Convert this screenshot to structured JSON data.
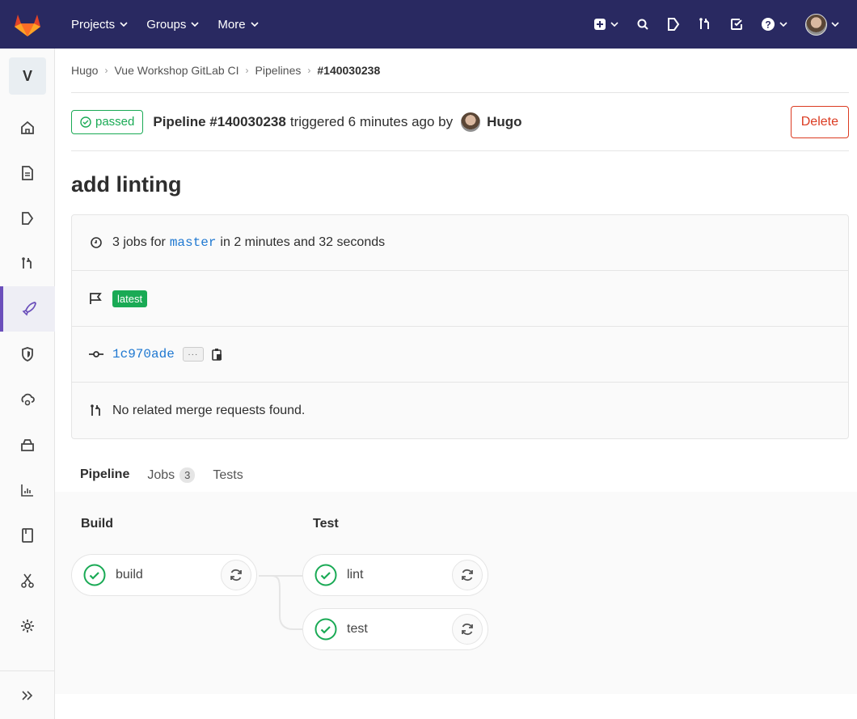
{
  "topbar": {
    "logo": "gitlab-tanuki-logo",
    "nav": [
      {
        "label": "Projects"
      },
      {
        "label": "Groups"
      },
      {
        "label": "More"
      }
    ],
    "icons": [
      "plus-square-icon",
      "search-icon",
      "issues-icon",
      "merge-request-icon",
      "todo-icon",
      "help-icon",
      "user-avatar"
    ]
  },
  "sidebar": {
    "project_initial": "V",
    "items": [
      {
        "icon": "home-icon"
      },
      {
        "icon": "repository-icon"
      },
      {
        "icon": "issues-icon"
      },
      {
        "icon": "merge-request-icon"
      },
      {
        "icon": "rocket-icon",
        "active": true
      },
      {
        "icon": "shield-icon"
      },
      {
        "icon": "cloud-gear-icon"
      },
      {
        "icon": "package-icon"
      },
      {
        "icon": "analytics-icon"
      },
      {
        "icon": "wiki-icon"
      },
      {
        "icon": "snippets-icon"
      },
      {
        "icon": "settings-icon"
      }
    ],
    "collapse_icon": "double-chevron-right-icon"
  },
  "breadcrumb": {
    "items": [
      "Hugo",
      "Vue Workshop GitLab CI",
      "Pipelines"
    ],
    "current": "#140030238"
  },
  "header": {
    "status": "passed",
    "pipeline_label": "Pipeline #140030238",
    "triggered_text": "triggered 6 minutes ago by",
    "author": "Hugo",
    "delete_label": "Delete"
  },
  "title": "add linting",
  "info": {
    "jobs_prefix": "3 jobs for",
    "branch": "master",
    "jobs_suffix": "in 2 minutes and 32 seconds",
    "latest_badge": "latest",
    "commit_sha": "1c970ade",
    "ellipsis": "···",
    "mr_text": "No related merge requests found."
  },
  "tabs": [
    {
      "label": "Pipeline",
      "active": true
    },
    {
      "label": "Jobs",
      "count": "3"
    },
    {
      "label": "Tests"
    }
  ],
  "stages": [
    {
      "name": "Build",
      "jobs": [
        {
          "name": "build",
          "status": "success"
        }
      ]
    },
    {
      "name": "Test",
      "jobs": [
        {
          "name": "lint",
          "status": "success"
        },
        {
          "name": "test",
          "status": "success"
        }
      ]
    }
  ],
  "colors": {
    "navbar": "#292961",
    "success": "#1aaa55",
    "danger": "#db3b21",
    "link": "#1f78d1",
    "active_sidebar": "#6b4fbb"
  }
}
